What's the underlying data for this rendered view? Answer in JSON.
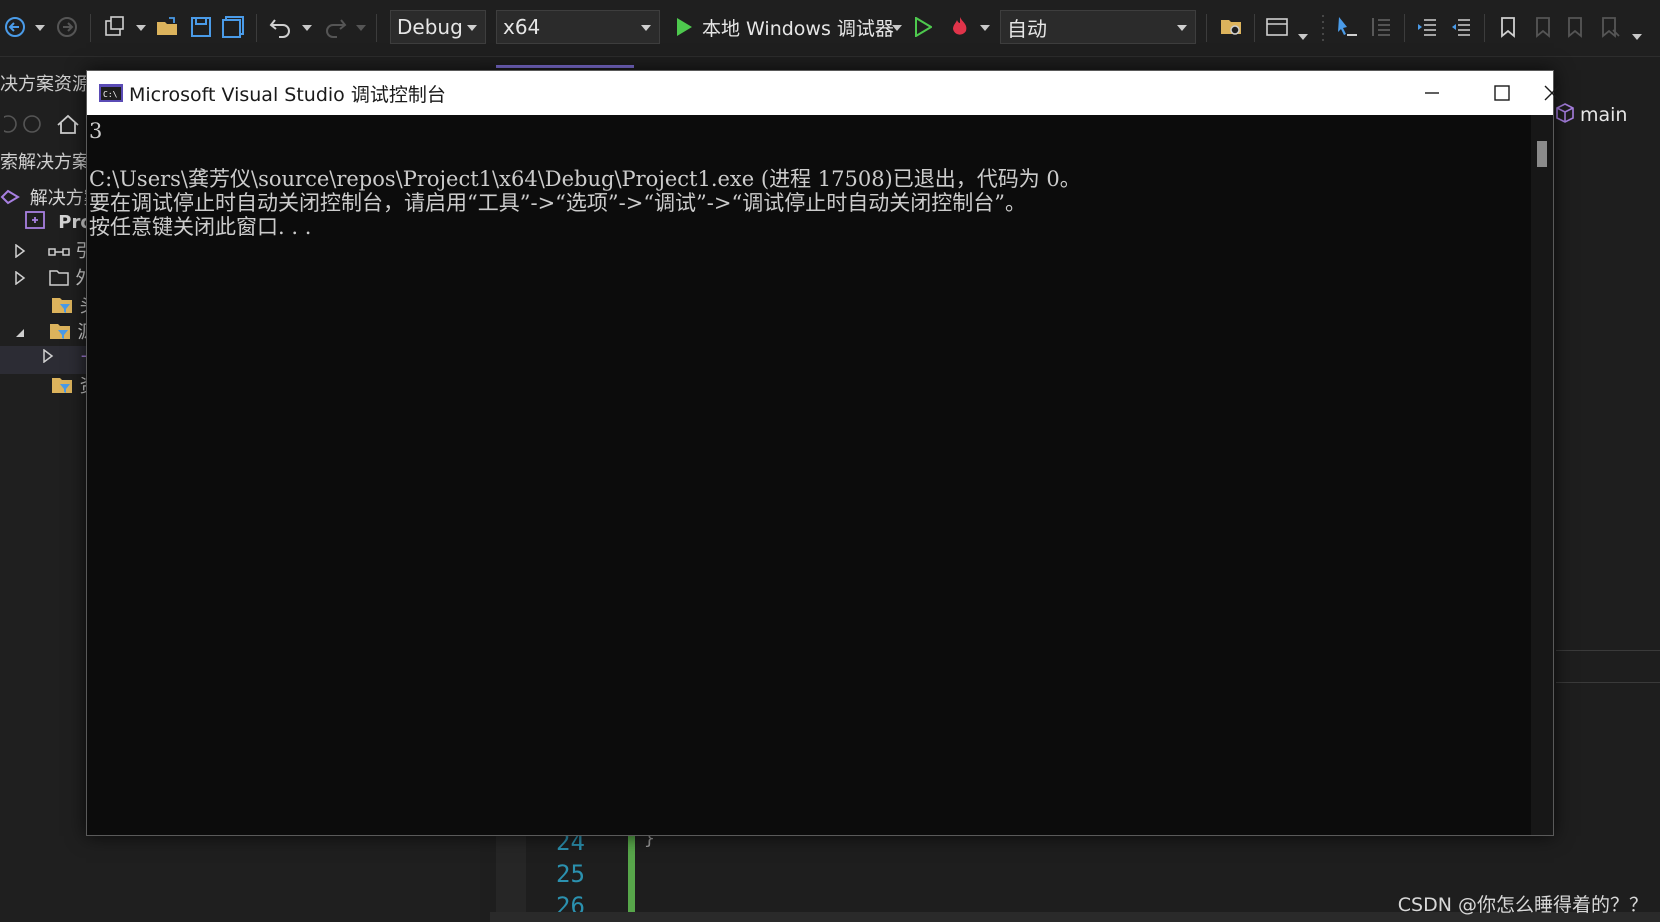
{
  "toolbar": {
    "config": "Debug",
    "platform": "x64",
    "run_target": "本地 Windows 调试器",
    "stack_frame": "自动"
  },
  "solution": {
    "title": "决方案资源",
    "search": "索解决方案",
    "tree": [
      {
        "label": "解决方案"
      },
      {
        "label": "Proj"
      },
      {
        "label": "引"
      },
      {
        "label": "外"
      },
      {
        "label": "头"
      },
      {
        "label": "源"
      },
      {
        "label": "+"
      },
      {
        "label": "资"
      }
    ]
  },
  "editor": {
    "nav_scope": "main",
    "line_numbers": [
      "24",
      "25",
      "26"
    ],
    "code_snippet": "}"
  },
  "console": {
    "title": "Microsoft Visual Studio 调试控制台",
    "lines": [
      "3",
      "",
      "C:\\Users\\龚芳仪\\source\\repos\\Project1\\x64\\Debug\\Project1.exe (进程 17508)已退出，代码为 0。",
      "要在调试停止时自动关闭控制台，请启用“工具”->“选项”->“调试”->“调试停止时自动关闭控制台”。",
      "按任意键关闭此窗口. . ."
    ]
  },
  "watermark": "CSDN @你怎么睡得着的？？",
  "colors": {
    "accent": "#7f6fd6",
    "run_green": "#4ec94e",
    "line_number": "#2b91af",
    "change_bar": "#57a64a"
  }
}
